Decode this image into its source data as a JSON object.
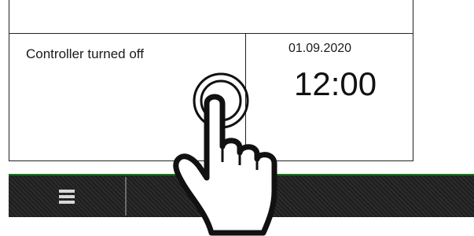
{
  "status": {
    "text": "Controller turned off"
  },
  "clock": {
    "date": "01.09.2020",
    "time": "12:00"
  },
  "bottom_bar": {
    "menu_icon": "hamburger-menu-icon"
  },
  "colors": {
    "accent_line": "#1a7a1a",
    "bar_background": "#262626"
  },
  "overlay": {
    "gesture_icon": "tap-hand-icon"
  }
}
